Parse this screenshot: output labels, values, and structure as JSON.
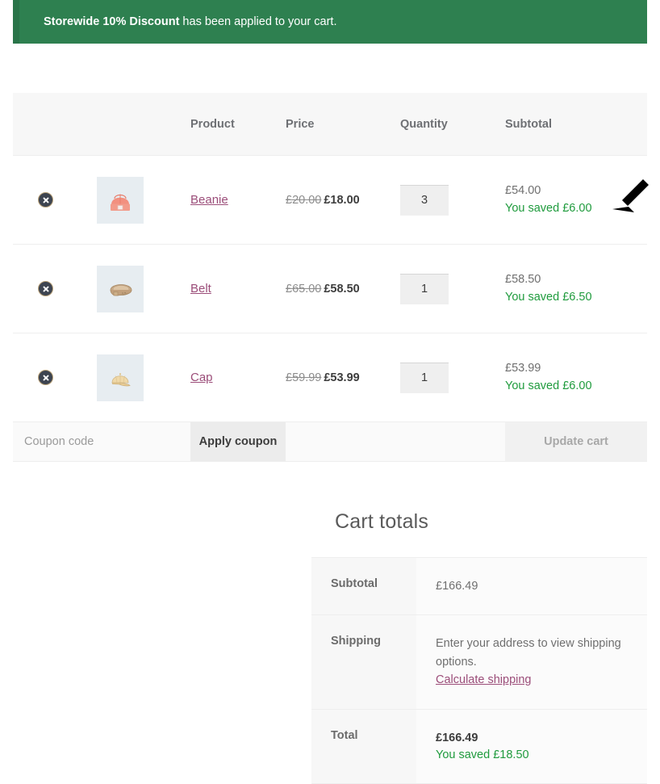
{
  "notice": {
    "bold_text": "Storewide 10% Discount",
    "rest_text": " has been applied to your cart."
  },
  "cart_table": {
    "headers": {
      "remove": "",
      "thumbnail": "",
      "product": "Product",
      "price": "Price",
      "quantity": "Quantity",
      "subtotal": "Subtotal"
    },
    "items": [
      {
        "remove_icon": "remove-item-icon",
        "thumb_icon": "beanie-thumbnail",
        "name": "Beanie",
        "price_old": "£20.00",
        "price_new": "£18.00",
        "quantity": "3",
        "subtotal": "£54.00",
        "saved": "You saved £6.00"
      },
      {
        "remove_icon": "remove-item-icon",
        "thumb_icon": "belt-thumbnail",
        "name": "Belt",
        "price_old": "£65.00",
        "price_new": "£58.50",
        "quantity": "1",
        "subtotal": "£58.50",
        "saved": "You saved £6.50"
      },
      {
        "remove_icon": "remove-item-icon",
        "thumb_icon": "cap-thumbnail",
        "name": "Cap",
        "price_old": "£59.99",
        "price_new": "£53.99",
        "quantity": "1",
        "subtotal": "£53.99",
        "saved": "You saved £6.00"
      }
    ],
    "coupon": {
      "placeholder": "Coupon code",
      "value": "",
      "apply_label": "Apply coupon",
      "update_label": "Update cart"
    }
  },
  "cart_totals": {
    "title": "Cart totals",
    "subtotal_label": "Subtotal",
    "subtotal_value": "£166.49",
    "shipping_label": "Shipping",
    "shipping_text": "Enter your address to view shipping options.",
    "shipping_link": "Calculate shipping",
    "total_label": "Total",
    "total_value": "£166.49",
    "total_saved": "You saved £18.50"
  },
  "annotation": {
    "cursor_icon": "arrow-cursor"
  },
  "colors": {
    "notice_green": "#2e8050",
    "saved_green": "#1f9b3d",
    "link_purple": "#9b4d79",
    "header_gray": "#f7f7f7"
  }
}
